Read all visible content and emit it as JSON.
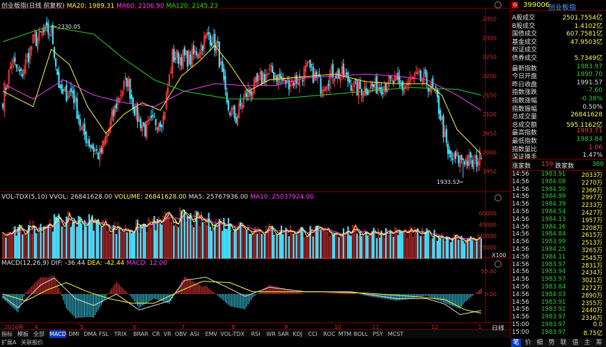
{
  "header": {
    "title": "创业板指(日线 前复权)",
    "ma": [
      {
        "label": "MA20: 1989.31",
        "color": "#ffff3b"
      },
      {
        "label": "MA60: 2106.90",
        "color": "#ff40ff"
      },
      {
        "label": "MA120: 2145.23",
        "color": "#26d926"
      }
    ]
  },
  "volume_header": {
    "name": "VOL-TDX(5,10)",
    "items": [
      {
        "label": "VVOL: 26841628.00",
        "color": "#e0e0e0"
      },
      {
        "label": "VOLUME: 26841628.00",
        "color": "#ffff3b"
      },
      {
        "label": "MA5: 25767936.00",
        "color": "#e0e0e0"
      },
      {
        "label": "MA10: 25037924.00",
        "color": "#ff40ff"
      }
    ]
  },
  "macd_header": {
    "name": "MACD(12,26,9)",
    "items": [
      {
        "label": "DIF: -36.44",
        "color": "#e0e0e0"
      },
      {
        "label": "DEA: -42.44",
        "color": "#ffff3b"
      },
      {
        "label": "MACD: 12.00",
        "color": "#ff40ff"
      }
    ]
  },
  "annotations": {
    "high": "2330.05",
    "low": "1933.52"
  },
  "period_label": "日线",
  "volume_unit": "X100",
  "chart_data": [
    {
      "type": "candlestick",
      "title": "创业板指(日线 前复权)",
      "ylim": [
        1910,
        2370
      ],
      "yticks": [
        1950,
        2000,
        2050,
        2100,
        2150,
        2200,
        2250,
        2300,
        2350
      ],
      "xticks": [
        {
          "label": "2016年",
          "index": 0
        },
        {
          "label": "4",
          "index": 20
        },
        {
          "label": "5",
          "index": 50
        },
        {
          "label": "6",
          "index": 85
        },
        {
          "label": "7",
          "index": 117
        },
        {
          "label": "8",
          "index": 150
        },
        {
          "label": "9",
          "index": 185
        },
        {
          "label": "10",
          "index": 218
        },
        {
          "label": "11",
          "index": 243
        },
        {
          "label": "12",
          "index": 282
        },
        {
          "label": "1",
          "index": 313
        }
      ],
      "high_label": {
        "value": 2330.05,
        "index": 32
      },
      "low_label": {
        "value": 1933.52,
        "index": 304
      },
      "last": {
        "open": 1984.5,
        "high": 1993.71,
        "low": 1983.84,
        "close": 1983.97
      },
      "anchors": [
        [
          0,
          2140
        ],
        [
          6,
          2240
        ],
        [
          12,
          2200
        ],
        [
          20,
          2290
        ],
        [
          26,
          2310
        ],
        [
          32,
          2320
        ],
        [
          38,
          2150
        ],
        [
          46,
          2160
        ],
        [
          52,
          2060
        ],
        [
          58,
          2020
        ],
        [
          64,
          1990
        ],
        [
          70,
          2060
        ],
        [
          76,
          2140
        ],
        [
          82,
          2190
        ],
        [
          88,
          2100
        ],
        [
          94,
          2060
        ],
        [
          100,
          2080
        ],
        [
          106,
          2090
        ],
        [
          112,
          2250
        ],
        [
          118,
          2250
        ],
        [
          124,
          2245
        ],
        [
          130,
          2275
        ],
        [
          136,
          2310
        ],
        [
          142,
          2270
        ],
        [
          148,
          2120
        ],
        [
          154,
          2090
        ],
        [
          160,
          2150
        ],
        [
          166,
          2170
        ],
        [
          172,
          2200
        ],
        [
          178,
          2210
        ],
        [
          186,
          2185
        ],
        [
          194,
          2190
        ],
        [
          202,
          2220
        ],
        [
          210,
          2175
        ],
        [
          218,
          2210
        ],
        [
          226,
          2200
        ],
        [
          234,
          2165
        ],
        [
          242,
          2170
        ],
        [
          250,
          2175
        ],
        [
          258,
          2185
        ],
        [
          264,
          2170
        ],
        [
          272,
          2195
        ],
        [
          280,
          2185
        ],
        [
          286,
          2150
        ],
        [
          290,
          2080
        ],
        [
          294,
          1990
        ],
        [
          298,
          1980
        ],
        [
          304,
          1985
        ],
        [
          310,
          1970
        ],
        [
          316,
          1990
        ]
      ],
      "series": [
        {
          "name": "MA20",
          "value": 1989.31,
          "color": "#ffff3b",
          "anchors": [
            [
              0,
              2160
            ],
            [
              20,
              2120
            ],
            [
              32,
              2270
            ],
            [
              44,
              2230
            ],
            [
              56,
              2120
            ],
            [
              68,
              2050
            ],
            [
              80,
              2100
            ],
            [
              92,
              2130
            ],
            [
              104,
              2110
            ],
            [
              118,
              2200
            ],
            [
              130,
              2240
            ],
            [
              140,
              2280
            ],
            [
              150,
              2230
            ],
            [
              162,
              2160
            ],
            [
              176,
              2190
            ],
            [
              190,
              2195
            ],
            [
              204,
              2200
            ],
            [
              220,
              2205
            ],
            [
              240,
              2185
            ],
            [
              260,
              2180
            ],
            [
              280,
              2180
            ],
            [
              290,
              2150
            ],
            [
              300,
              2060
            ],
            [
              310,
              2020
            ],
            [
              316,
              1995
            ]
          ]
        },
        {
          "name": "MA60",
          "value": 2106.9,
          "color": "#ff40ff",
          "anchors": [
            [
              0,
              2180
            ],
            [
              20,
              2140
            ],
            [
              40,
              2190
            ],
            [
              60,
              2150
            ],
            [
              80,
              2130
            ],
            [
              100,
              2120
            ],
            [
              120,
              2160
            ],
            [
              140,
              2180
            ],
            [
              160,
              2175
            ],
            [
              180,
              2175
            ],
            [
              200,
              2195
            ],
            [
              220,
              2200
            ],
            [
              240,
              2205
            ],
            [
              260,
              2200
            ],
            [
              280,
              2190
            ],
            [
              300,
              2150
            ],
            [
              316,
              2110
            ]
          ]
        },
        {
          "name": "MA120",
          "value": 2145.23,
          "color": "#26d926",
          "anchors": [
            [
              0,
              2290
            ],
            [
              30,
              2330
            ],
            [
              60,
              2310
            ],
            [
              80,
              2245
            ],
            [
              100,
              2190
            ],
            [
              120,
              2160
            ],
            [
              150,
              2140
            ],
            [
              180,
              2140
            ],
            [
              210,
              2150
            ],
            [
              240,
              2160
            ],
            [
              270,
              2170
            ],
            [
              300,
              2165
            ],
            [
              316,
              2150
            ]
          ]
        }
      ]
    },
    {
      "type": "bar",
      "title": "VOL-TDX(5,10)",
      "ylim": [
        0,
        75000
      ],
      "yticks": [
        15000,
        30000,
        45000,
        60000
      ],
      "last_value": 268416.28,
      "anchors": [
        [
          0,
          30000
        ],
        [
          20,
          42000
        ],
        [
          40,
          50000
        ],
        [
          60,
          48000
        ],
        [
          80,
          38000
        ],
        [
          100,
          46000
        ],
        [
          115,
          55000
        ],
        [
          130,
          50000
        ],
        [
          150,
          46000
        ],
        [
          170,
          38000
        ],
        [
          190,
          37000
        ],
        [
          210,
          35000
        ],
        [
          230,
          36000
        ],
        [
          250,
          35000
        ],
        [
          270,
          34000
        ],
        [
          290,
          30000
        ],
        [
          305,
          25000
        ],
        [
          316,
          27000
        ]
      ]
    },
    {
      "type": "bar",
      "title": "MACD(12,26,9)",
      "ylim": [
        -58,
        58
      ],
      "yticks": [
        0,
        50
      ],
      "DIF": -36.44,
      "DEA": -42.44,
      "MACD": 12.0,
      "dif_anchors": [
        [
          0,
          -5
        ],
        [
          10,
          -30
        ],
        [
          25,
          20
        ],
        [
          34,
          35
        ],
        [
          48,
          -10
        ],
        [
          60,
          -25
        ],
        [
          75,
          0
        ],
        [
          90,
          -35
        ],
        [
          110,
          -15
        ],
        [
          120,
          30
        ],
        [
          134,
          37
        ],
        [
          148,
          15
        ],
        [
          160,
          -5
        ],
        [
          176,
          15
        ],
        [
          200,
          5
        ],
        [
          230,
          5
        ],
        [
          260,
          -10
        ],
        [
          280,
          -10
        ],
        [
          292,
          -22
        ],
        [
          302,
          -45
        ],
        [
          316,
          -36
        ]
      ],
      "dea_anchors": [
        [
          0,
          0
        ],
        [
          15,
          -15
        ],
        [
          30,
          10
        ],
        [
          42,
          25
        ],
        [
          56,
          5
        ],
        [
          70,
          -10
        ],
        [
          85,
          -20
        ],
        [
          100,
          -20
        ],
        [
          116,
          5
        ],
        [
          132,
          28
        ],
        [
          150,
          25
        ],
        [
          165,
          5
        ],
        [
          185,
          5
        ],
        [
          210,
          5
        ],
        [
          240,
          2
        ],
        [
          270,
          -5
        ],
        [
          292,
          -12
        ],
        [
          305,
          -34
        ],
        [
          316,
          -42
        ]
      ]
    }
  ],
  "tabs": [
    "指标",
    "模板",
    "全部",
    "MACD",
    "DMI",
    "DMA",
    "FSL",
    "TRIX",
    "BRAR",
    "CR",
    "VR",
    "OBV",
    "ASI",
    "EMV",
    "VOL-TDX",
    "RSI",
    "WR",
    "SAR",
    "KDJ",
    "CCI",
    "ROC",
    "MTM",
    "BOLL",
    "PSY",
    "MCST"
  ],
  "bottom_tabs": [
    "扩展A",
    "关联报价"
  ],
  "panel": {
    "code": "399006",
    "name": "创业板指",
    "stats": [
      {
        "label": "A股成交",
        "value": "2501.7554亿",
        "color": "#ffff3b"
      },
      {
        "label": "B股成交",
        "value": "1.4102亿",
        "color": "#ffff3b"
      },
      {
        "label": "国债成交",
        "value": "607.7581亿",
        "color": "#ffff3b"
      },
      {
        "label": "基金成交",
        "value": "47.9503亿",
        "color": "#ffff3b"
      },
      {
        "label": "权证成交",
        "value": "",
        "color": "#ffff3b"
      },
      {
        "label": "债券成交",
        "value": "5.7349亿",
        "color": "#ffff3b"
      },
      {
        "label": "最新指数",
        "value": "1983.97",
        "color": "#26d926"
      },
      {
        "label": "今日开盘",
        "value": "1990.70",
        "color": "#26d926"
      },
      {
        "label": "昨日收盘",
        "value": "1991.57",
        "color": "#e0e0e0"
      },
      {
        "label": "指数涨跌",
        "value": "-7.60",
        "color": "#26d926"
      },
      {
        "label": "指数涨幅",
        "value": "-0.38%",
        "color": "#26d926"
      },
      {
        "label": "指数振幅",
        "value": "0.50%",
        "color": "#e0e0e0"
      },
      {
        "label": "总成交量",
        "value": "26841628",
        "color": "#ffff3b"
      },
      {
        "label": "总成交额",
        "value": "595.1162亿",
        "color": "#ffff3b"
      },
      {
        "label": "最高指数",
        "value": "1993.71",
        "color": "#ff3b3b"
      },
      {
        "label": "最低指数",
        "value": "1983.84",
        "color": "#26d926"
      },
      {
        "label": "指数量比",
        "value": "1.06",
        "color": "#ff3b3b"
      },
      {
        "label": "深证换手",
        "value": "1.47%",
        "color": "#e0e0e0"
      }
    ],
    "updown": {
      "up_label": "涨家数",
      "up": "159",
      "down_label": "跌家数",
      "down": "360"
    },
    "ticks": [
      {
        "t": "14:56",
        "p": "1983.91",
        "v": "2033万"
      },
      {
        "t": "14:56",
        "p": "1984.08",
        "v": "2270万"
      },
      {
        "t": "14:56",
        "p": "1984.50",
        "v": "2366万"
      },
      {
        "t": "14:56",
        "p": "1984.99",
        "v": "2997万"
      },
      {
        "t": "14:56",
        "p": "1984.39",
        "v": "2233万"
      },
      {
        "t": "14:56",
        "p": "1984.54",
        "v": "2427万"
      },
      {
        "t": "14:56",
        "p": "1984.13",
        "v": "1957万"
      },
      {
        "t": "14:56",
        "p": "1984.16",
        "v": "2208万"
      },
      {
        "t": "14:56",
        "p": "1984.84",
        "v": "2615万"
      },
      {
        "t": "14:56",
        "p": "1983.99",
        "v": "2513万"
      },
      {
        "t": "14:56",
        "p": "1984.25",
        "v": "3265万"
      },
      {
        "t": "14:56",
        "p": "1984.11",
        "v": "2545万"
      },
      {
        "t": "14:56",
        "p": "1983.97",
        "v": "2831万"
      },
      {
        "t": "14:56",
        "p": "1983.94",
        "v": "2434万"
      },
      {
        "t": "14:56",
        "p": "1983.97",
        "v": "3021万"
      },
      {
        "t": "14:56",
        "p": "1983.84",
        "v": "2272万"
      },
      {
        "t": "14:56",
        "p": "1984.03",
        "v": "2890万"
      },
      {
        "t": "14:56",
        "p": "1983.91",
        "v": "2355万"
      },
      {
        "t": "14:56",
        "p": "1983.92",
        "v": "2440万"
      },
      {
        "t": "14:56",
        "p": "1983.97",
        "v": "2336万"
      },
      {
        "t": "15:00",
        "p": "1983.97",
        "v": "0.0"
      },
      {
        "t": "15:00",
        "p": "1983.97",
        "v": "8.75亿"
      }
    ],
    "bottom_tabs": [
      "笔",
      "价",
      "细",
      "势",
      "联",
      "值",
      "主",
      "筹"
    ]
  }
}
